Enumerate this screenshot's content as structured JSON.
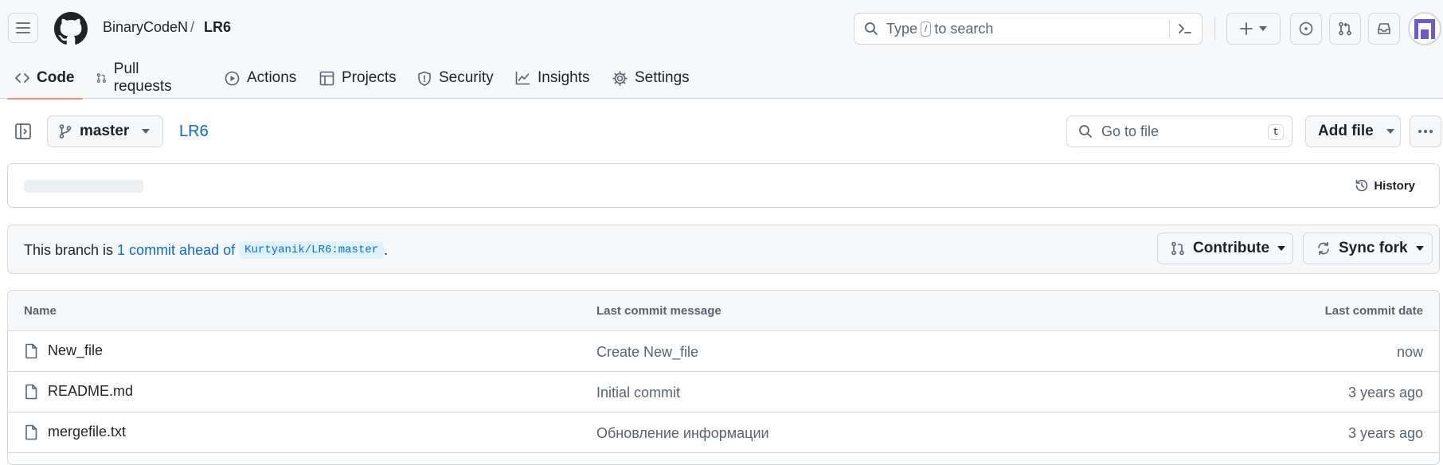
{
  "header": {
    "owner": "BinaryCodeN",
    "separator": "/",
    "repo": "LR6",
    "search": {
      "prefix": "Type",
      "key": "/",
      "suffix": "to search"
    }
  },
  "tabs": [
    {
      "label": "Code",
      "icon": "code-icon",
      "active": true
    },
    {
      "label": "Pull requests",
      "icon": "git-pull-request-icon"
    },
    {
      "label": "Actions",
      "icon": "play-icon"
    },
    {
      "label": "Projects",
      "icon": "table-icon"
    },
    {
      "label": "Security",
      "icon": "shield-icon"
    },
    {
      "label": "Insights",
      "icon": "graph-icon"
    },
    {
      "label": "Settings",
      "icon": "gear-icon"
    }
  ],
  "repo_bar": {
    "branch": "master",
    "repo_name": "LR6",
    "goto_placeholder": "Go to file",
    "goto_key": "t",
    "add_file": "Add file"
  },
  "commit_box": {
    "history": "History"
  },
  "branch_info": {
    "prefix": "This branch is ",
    "link": "1 commit ahead of",
    "ref": "Kurtyanik/LR6:master",
    "suffix": ".",
    "contribute": "Contribute",
    "sync_fork": "Sync fork"
  },
  "table": {
    "headers": {
      "name": "Name",
      "message": "Last commit message",
      "date": "Last commit date"
    },
    "rows": [
      {
        "name": "New_file",
        "message": "Create New_file",
        "date": "now"
      },
      {
        "name": "README.md",
        "message": "Initial commit",
        "date": "3 years ago"
      },
      {
        "name": "mergefile.txt",
        "message": "Обновление информации",
        "date": "3 years ago"
      }
    ]
  },
  "colors": {
    "link": "#0969da",
    "tab_underline": "#fd8c73",
    "border": "#d0d7de",
    "muted": "#59636e"
  }
}
